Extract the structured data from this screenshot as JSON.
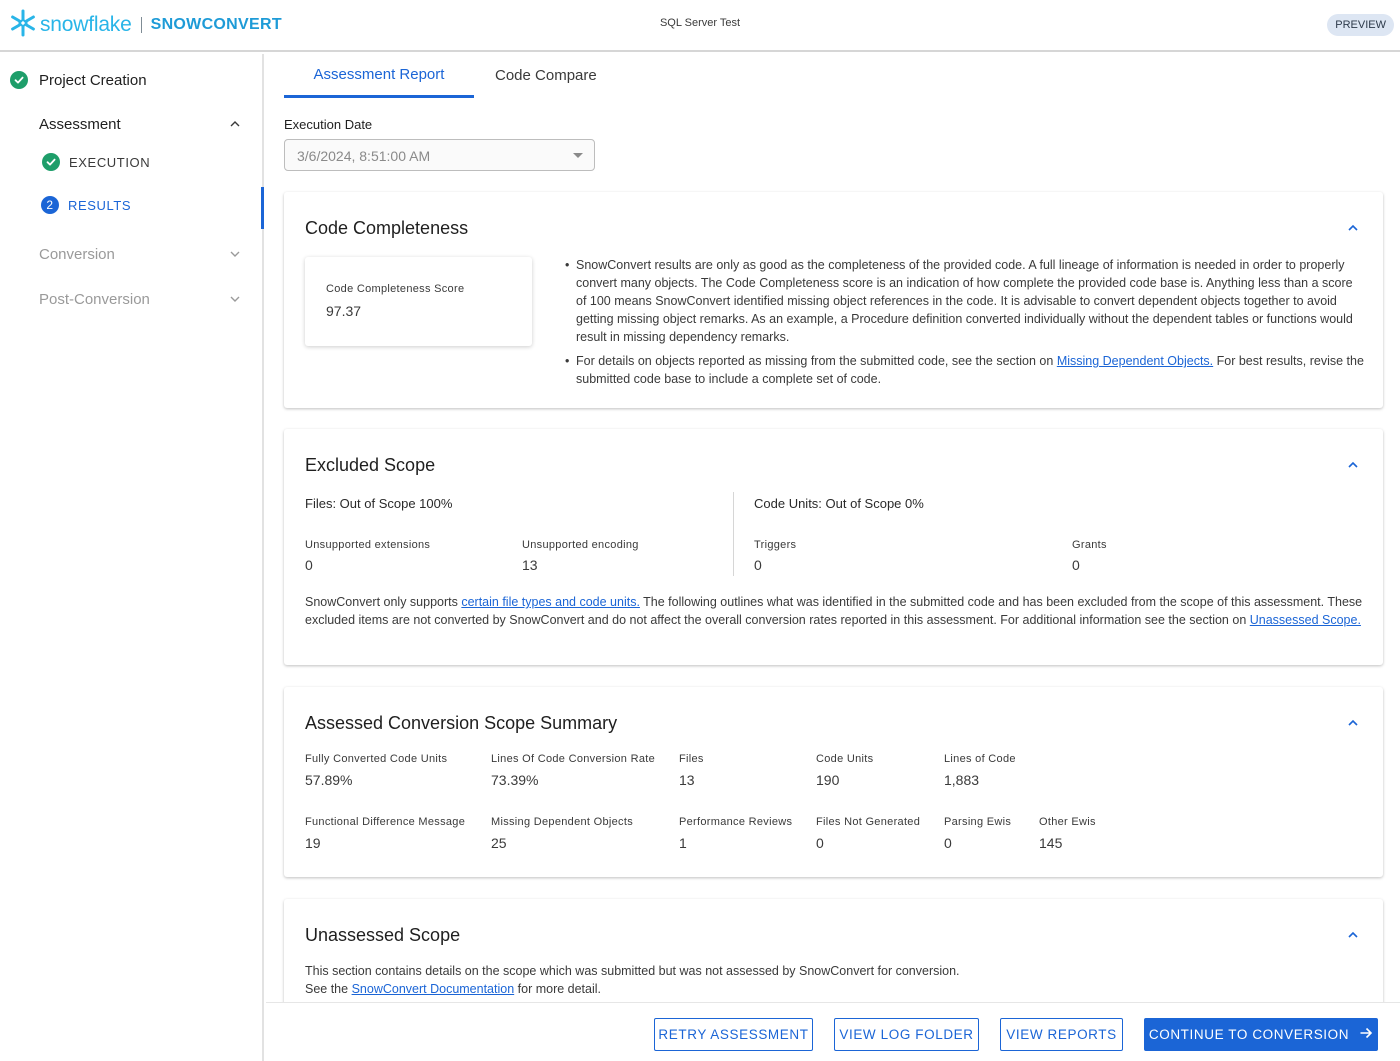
{
  "header": {
    "brand": "snowflake",
    "product": "SNOWCONVERT",
    "project_title": "SQL Server Test",
    "badge": "PREVIEW"
  },
  "sidebar": {
    "project_creation": "Project Creation",
    "groups": [
      {
        "label": "Assessment",
        "state": "expanded"
      },
      {
        "label": "Conversion",
        "state": "collapsed"
      },
      {
        "label": "Post-Conversion",
        "state": "collapsed"
      }
    ],
    "substeps": [
      {
        "label": "EXECUTION",
        "status": "done"
      },
      {
        "label": "RESULTS",
        "status": "current",
        "number": "2"
      }
    ]
  },
  "tabs": [
    {
      "label": "Assessment Report",
      "active": true
    },
    {
      "label": "Code Compare",
      "active": false
    }
  ],
  "execution_date": {
    "label": "Execution Date",
    "value": "3/6/2024, 8:51:00 AM"
  },
  "code_completeness": {
    "title": "Code Completeness",
    "score_label": "Code Completeness Score",
    "score_value": "97.37",
    "bullet1": "SnowConvert results are only as good as the completeness of the provided code. A full lineage of information is needed in order to properly convert many objects. The Code Completeness score is an indication of how complete the provided code base is. Anything less than a score of 100 means SnowConvert identified missing object references in the code. It is advisable to convert dependent objects together to avoid getting missing object remarks. As an example, a Procedure definition converted individually without the dependent tables or functions would result in missing dependency remarks.",
    "bullet2_pre": "For details on objects reported as missing from the submitted code, see the section on ",
    "bullet2_link": "Missing Dependent Objects.",
    "bullet2_post": " For best results, revise the submitted code base to include a complete set of code."
  },
  "excluded_scope": {
    "title": "Excluded Scope",
    "files_heading": "Files: Out of Scope 100%",
    "units_heading": "Code Units: Out of Scope 0%",
    "stats": [
      {
        "label": "Unsupported extensions",
        "value": "0"
      },
      {
        "label": "Unsupported encoding",
        "value": "13"
      },
      {
        "label": "Triggers",
        "value": "0"
      },
      {
        "label": "Grants",
        "value": "0"
      }
    ],
    "para_pre": "SnowConvert only supports ",
    "para_link1": "certain file types and code units.",
    "para_mid": " The following outlines what was identified in the submitted code and has been excluded from the scope of this assessment. These excluded items are not converted by SnowConvert and do not affect the overall conversion rates reported in this assessment. For additional information see the section on ",
    "para_link2": "Unassessed Scope."
  },
  "assessed_summary": {
    "title": "Assessed Conversion Scope Summary",
    "row1": [
      {
        "label": "Fully Converted Code Units",
        "value": "57.89%"
      },
      {
        "label": "Lines Of Code Conversion Rate",
        "value": "73.39%"
      },
      {
        "label": "Files",
        "value": "13"
      },
      {
        "label": "Code Units",
        "value": "190"
      },
      {
        "label": "Lines of Code",
        "value": "1,883"
      }
    ],
    "row2": [
      {
        "label": "Functional Difference Message",
        "value": "19"
      },
      {
        "label": "Missing Dependent Objects",
        "value": "25"
      },
      {
        "label": "Performance Reviews",
        "value": "1"
      },
      {
        "label": "Files Not Generated",
        "value": "0"
      },
      {
        "label": "Parsing Ewis",
        "value": "0"
      },
      {
        "label": "Other Ewis",
        "value": "145"
      }
    ]
  },
  "unassessed_scope": {
    "title": "Unassessed Scope",
    "line1": "This section contains details on the scope which was submitted but was not assessed by SnowConvert for conversion.",
    "line2_pre": "See the ",
    "line2_link": "SnowConvert Documentation",
    "line2_post": " for more detail."
  },
  "footer": {
    "retry": "RETRY ASSESSMENT",
    "view_log": "VIEW LOG FOLDER",
    "view_reports": "VIEW REPORTS",
    "continue": "CONTINUE TO CONVERSION"
  },
  "colors": {
    "accent": "#1b65d6",
    "brand": "#29b5e8",
    "success": "#1e9e6a"
  },
  "icons": [
    "snowflake-logo-icon",
    "check-circle-icon",
    "chevron-up-icon",
    "chevron-down-icon",
    "dropdown-caret-icon",
    "arrow-right-icon"
  ]
}
